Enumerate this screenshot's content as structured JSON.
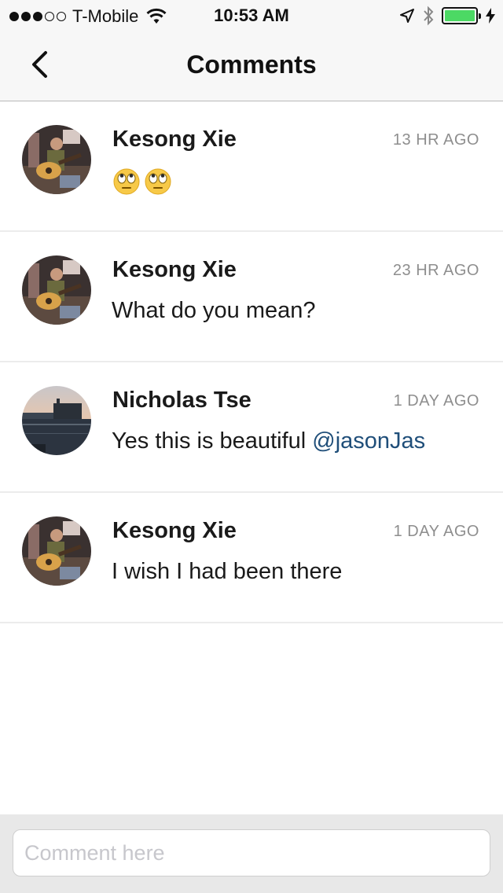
{
  "status_bar": {
    "carrier": "T-Mobile",
    "time": "10:53 AM",
    "signal_bars": 3,
    "signal_total": 5,
    "battery_level": 1.0,
    "battery_color": "#4cd964"
  },
  "nav": {
    "title": "Comments",
    "back_icon": "chevron-left-icon"
  },
  "comments": [
    {
      "author": "Kesong Xie",
      "time": "13 HR AGO",
      "text": "",
      "emoji": [
        "face-with-rolling-eyes",
        "face-with-rolling-eyes"
      ],
      "avatar": "guitar-player"
    },
    {
      "author": "Kesong Xie",
      "time": "23 HR AGO",
      "text": "What do you mean?",
      "avatar": "guitar-player"
    },
    {
      "author": "Nicholas Tse",
      "time": "1 DAY AGO",
      "text": "Yes this is beautiful ",
      "mention": "@jasonJas",
      "avatar": "harbor-sunset"
    },
    {
      "author": "Kesong Xie",
      "time": "1 DAY AGO",
      "text": "I wish I had been there",
      "avatar": "guitar-player"
    }
  ],
  "composer": {
    "placeholder": "Comment here",
    "value": ""
  },
  "colors": {
    "mention": "#1f4e79",
    "timestamp": "#8e8e8e",
    "divider": "#ececec"
  }
}
